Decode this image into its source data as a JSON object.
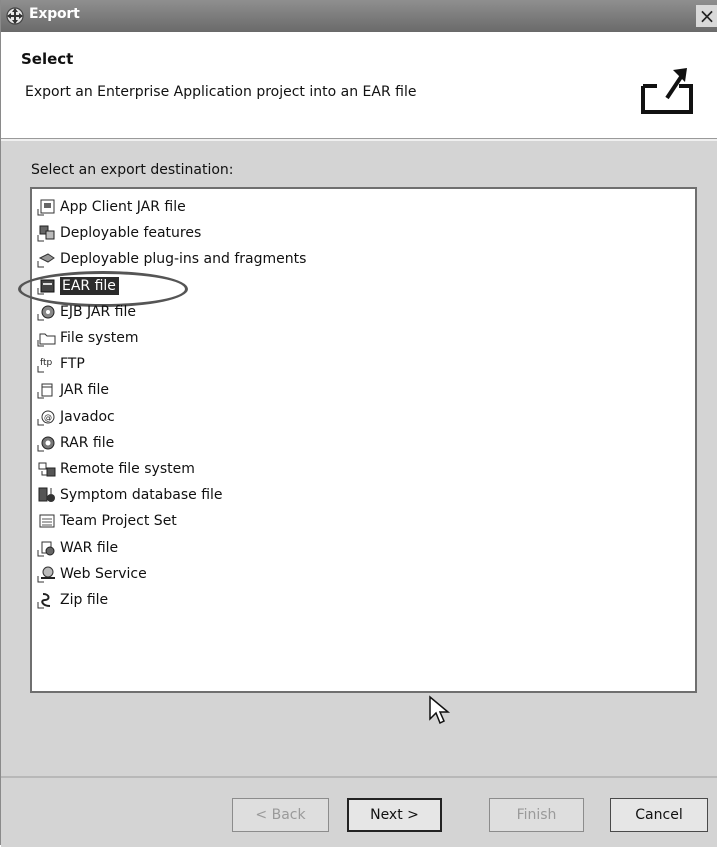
{
  "window": {
    "title": "Export",
    "close_glyph": "×"
  },
  "banner": {
    "title": "Select",
    "description": "Export an Enterprise Application project into an EAR file",
    "icon": "export-wizard-icon"
  },
  "main": {
    "prompt": "Select an export destination:",
    "items": [
      {
        "label": "App Client JAR file",
        "icon": "app-client-jar-icon"
      },
      {
        "label": "Deployable features",
        "icon": "features-icon"
      },
      {
        "label": "Deployable plug-ins and fragments",
        "icon": "plugins-icon"
      },
      {
        "label": "EAR file",
        "icon": "ear-file-icon",
        "selected": true
      },
      {
        "label": "EJB JAR file",
        "icon": "ejb-jar-icon"
      },
      {
        "label": "File system",
        "icon": "folder-icon"
      },
      {
        "label": "FTP",
        "icon": "ftp-icon"
      },
      {
        "label": "JAR file",
        "icon": "jar-icon"
      },
      {
        "label": "Javadoc",
        "icon": "javadoc-icon"
      },
      {
        "label": "RAR file",
        "icon": "rar-icon"
      },
      {
        "label": "Remote file system",
        "icon": "remote-fs-icon"
      },
      {
        "label": "Symptom database file",
        "icon": "symptom-db-icon"
      },
      {
        "label": "Team Project Set",
        "icon": "team-project-icon"
      },
      {
        "label": "WAR file",
        "icon": "war-icon"
      },
      {
        "label": "Web Service",
        "icon": "web-service-icon"
      },
      {
        "label": "Zip file",
        "icon": "zip-icon"
      }
    ]
  },
  "buttons": {
    "back": "< Back",
    "next": "Next >",
    "finish": "Finish",
    "cancel": "Cancel"
  }
}
